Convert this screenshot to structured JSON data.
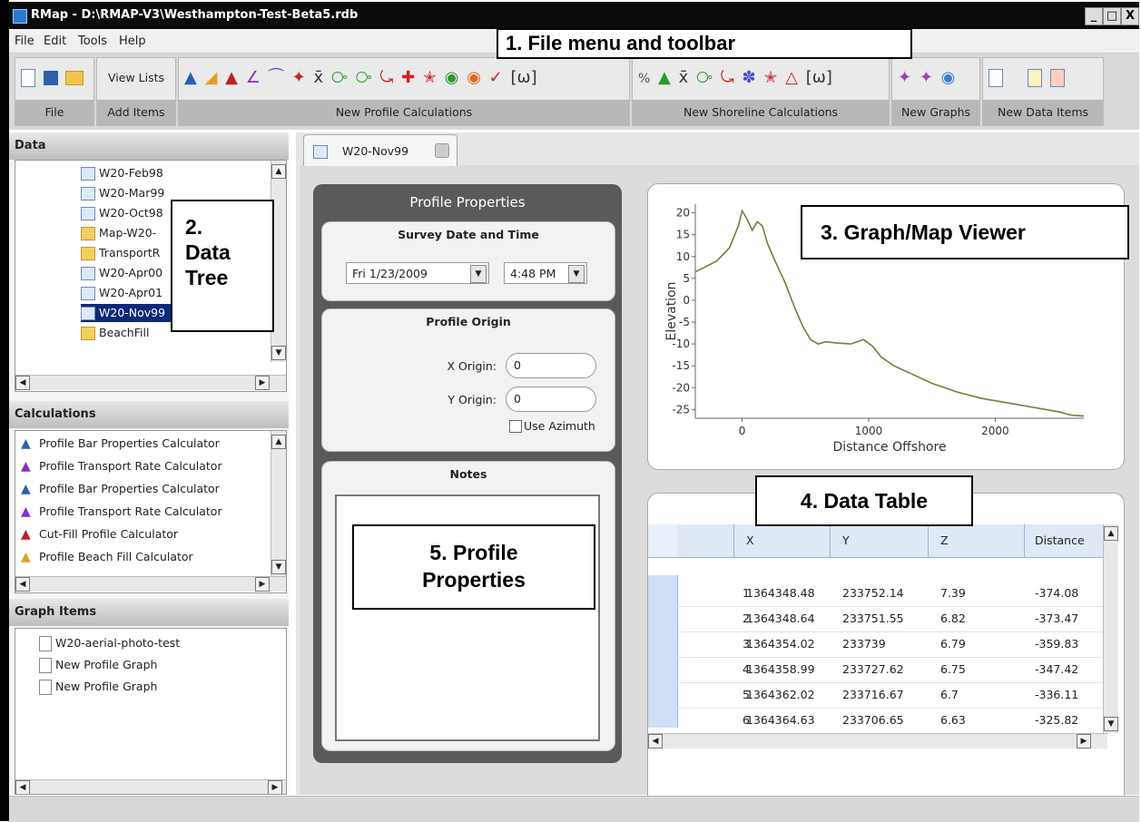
{
  "window": {
    "title": "RMap - D:\\RMAP-V3\\Westhampton-Test-Beta5.rdb",
    "buttons": [
      "_",
      "□",
      "X"
    ]
  },
  "menu": [
    "File",
    "Edit",
    "Tools",
    "Help"
  ],
  "toolbar": {
    "groups": [
      {
        "label": "File"
      },
      {
        "label": "Add Items",
        "button": "View Lists"
      },
      {
        "label": "New Profile Calculations"
      },
      {
        "label": "New Shoreline Calculations"
      },
      {
        "label": "New Graphs"
      },
      {
        "label": "New Data Items"
      }
    ]
  },
  "data_panel": {
    "title": "Data",
    "items": [
      {
        "label": "W20-Feb98",
        "icon": "file"
      },
      {
        "label": "W20-Mar99",
        "icon": "file"
      },
      {
        "label": "W20-Oct98",
        "icon": "file"
      },
      {
        "label": "Map-W20-",
        "icon": "folder"
      },
      {
        "label": "TransportR",
        "icon": "folder"
      },
      {
        "label": "W20-Apr00",
        "icon": "file"
      },
      {
        "label": "W20-Apr01",
        "icon": "file"
      },
      {
        "label": "W20-Nov99",
        "icon": "file",
        "selected": true
      },
      {
        "label": "BeachFill",
        "icon": "folder"
      }
    ]
  },
  "calc_panel": {
    "title": "Calculations",
    "items": [
      {
        "label": "Profile Bar Properties Calculator",
        "icon": "bar-calc-icon"
      },
      {
        "label": "Profile Transport Rate Calculator",
        "icon": "transport-calc-icon"
      },
      {
        "label": "Profile Bar Properties Calculator",
        "icon": "bar-calc-icon"
      },
      {
        "label": "Profile Transport Rate Calculator",
        "icon": "transport-calc-icon"
      },
      {
        "label": "Cut-Fill Profile Calculator",
        "icon": "cutfill-calc-icon"
      },
      {
        "label": "Profile Beach Fill Calculator",
        "icon": "beachfill-calc-icon"
      }
    ]
  },
  "graph_panel": {
    "title": "Graph Items",
    "items": [
      {
        "label": "W20-aerial-photo-test"
      },
      {
        "label": "New Profile Graph"
      },
      {
        "label": "New Profile Graph"
      }
    ]
  },
  "tab": {
    "label": "W20-Nov99"
  },
  "profile": {
    "title": "Profile Properties",
    "survey_title": "Survey Date and Time",
    "date": "Fri   1/23/2009",
    "time": "4:48 PM",
    "origin_title": "Profile Origin",
    "x_label": "X Origin:",
    "x_value": "0",
    "y_label": "Y Origin:",
    "y_value": "0",
    "azimuth_label": "Use Azimuth",
    "notes_title": "Notes"
  },
  "chart_data": {
    "type": "line",
    "xlabel": "Distance Offshore",
    "ylabel": "Elevation",
    "xlim": [
      -370,
      2700
    ],
    "ylim": [
      -27,
      22
    ],
    "xticks": [
      0,
      1000,
      2000
    ],
    "yticks": [
      20,
      15,
      10,
      5,
      0,
      -5,
      -10,
      -15,
      -20,
      -25
    ],
    "line_color": "#7a7a3a",
    "series": [
      {
        "x": [
          -370,
          -300,
          -200,
          -100,
          -30,
          0,
          40,
          80,
          120,
          160,
          200,
          260,
          340,
          420,
          480,
          540,
          600,
          660,
          760,
          860,
          960,
          1030,
          1100,
          1200,
          1350,
          1500,
          1700,
          1900,
          2100,
          2300,
          2500,
          2600,
          2700
        ],
        "y": [
          6.5,
          7.5,
          9,
          12,
          17,
          20.5,
          18.5,
          16,
          18,
          17,
          13,
          9,
          4,
          -2,
          -6,
          -9,
          -10,
          -9.5,
          -9.8,
          -10,
          -9,
          -10.5,
          -13,
          -15,
          -17,
          -19,
          -21,
          -22.5,
          -23.5,
          -24.5,
          -25.5,
          -26.3,
          -26.5
        ]
      }
    ]
  },
  "data_table": {
    "columns": [
      "X",
      "Y",
      "Z",
      "Distance"
    ],
    "rows": [
      {
        "n": "1",
        "x": "1364348.48",
        "y": "233752.14",
        "z": "7.39",
        "d": "-374.08"
      },
      {
        "n": "2",
        "x": "1364348.64",
        "y": "233751.55",
        "z": "6.82",
        "d": "-373.47"
      },
      {
        "n": "3",
        "x": "1364354.02",
        "y": "233739",
        "z": "6.79",
        "d": "-359.83"
      },
      {
        "n": "4",
        "x": "1364358.99",
        "y": "233727.62",
        "z": "6.75",
        "d": "-347.42"
      },
      {
        "n": "5",
        "x": "1364362.02",
        "y": "233716.67",
        "z": "6.7",
        "d": "-336.11"
      },
      {
        "n": "6",
        "x": "1364364.63",
        "y": "233706.65",
        "z": "6.63",
        "d": "-325.82"
      }
    ]
  },
  "annotations": {
    "a1": "1.  File menu and toolbar",
    "a2": [
      "2.",
      "Data",
      "Tree"
    ],
    "a3": "3.  Graph/Map Viewer",
    "a4": "4.  Data Table",
    "a5": [
      "5.  Profile",
      "Properties"
    ]
  }
}
